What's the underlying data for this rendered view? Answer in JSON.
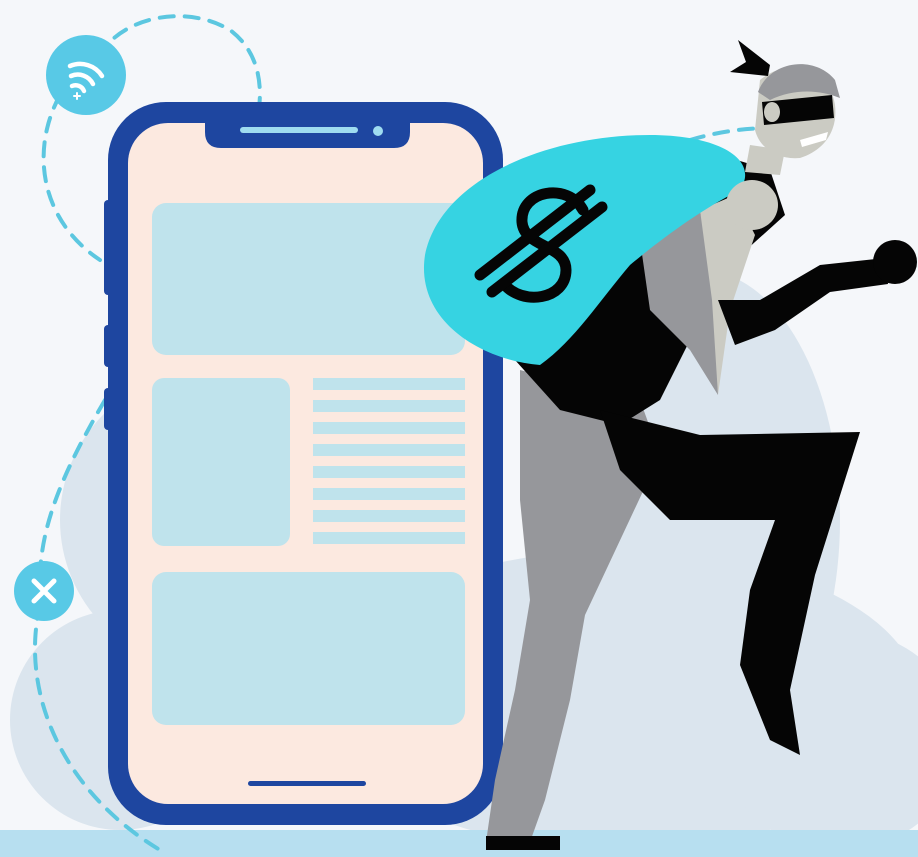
{
  "illustration": {
    "subject": "thief-with-money-bag-and-smartphone",
    "bag_symbol": "$",
    "icons": {
      "wifi_badge": "wifi-icon",
      "close_badge": "close-icon",
      "bag_symbol": "dollar-sign-icon"
    },
    "colors": {
      "background": "#f5f7fa",
      "blob": "#dbe5ee",
      "floor": "#b7dff0",
      "phone_frame": "#1e46a0",
      "phone_screen": "#fce9e0",
      "screen_block": "#bfe3ec",
      "accent_cyan": "#36d3e2",
      "dash_line": "#5cc7e0",
      "badge": "#58c9e6",
      "outfit_black": "#050505",
      "outfit_gray": "#96979b",
      "skin": "#cbcbc3",
      "white": "#ffffff"
    }
  }
}
